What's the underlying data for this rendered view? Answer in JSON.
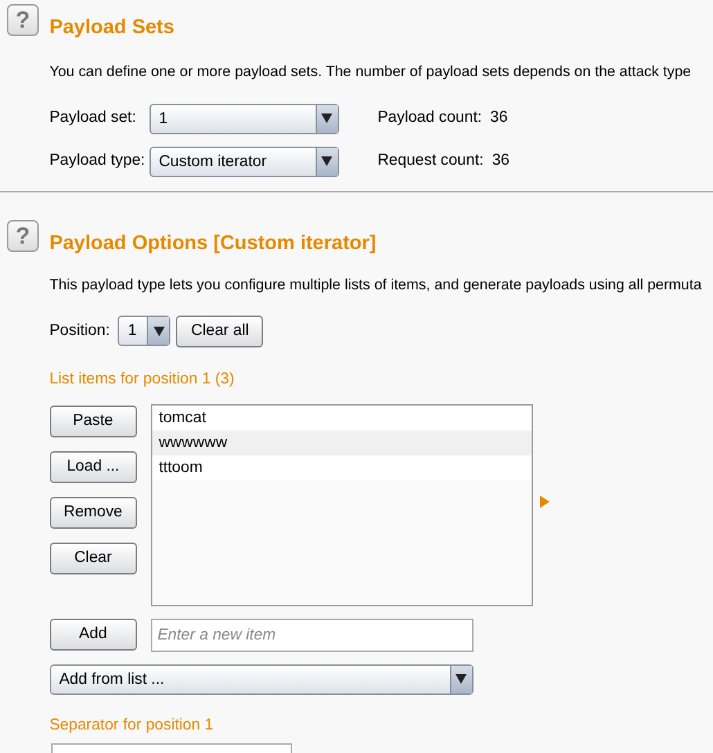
{
  "sections": [
    {
      "help": "?",
      "title": "Payload Sets",
      "description": "You can define one or more payload sets. The number of payload sets depends on the attack type",
      "fields": [
        {
          "label": "Payload set:",
          "value": "1",
          "stat_label": "Payload count:",
          "stat_value": "36"
        },
        {
          "label": "Payload type:",
          "value": "Custom iterator",
          "stat_label": "Request count:",
          "stat_value": "36"
        }
      ]
    },
    {
      "help": "?",
      "title": "Payload Options [Custom iterator]",
      "description": "This payload type lets you configure multiple lists of items, and generate payloads using all permuta",
      "position": {
        "label": "Position:",
        "value": "1",
        "clear_button": "Clear all"
      },
      "list_heading": "List items for position 1 (3)",
      "list_buttons": [
        "Paste",
        "Load ...",
        "Remove",
        "Clear"
      ],
      "items": [
        "tomcat",
        "wwwwww",
        "tttoom"
      ],
      "add_button": "Add",
      "add_placeholder": "Enter a new item",
      "add_from_list": "Add from list ...",
      "separator_heading": "Separator for position 1"
    }
  ]
}
